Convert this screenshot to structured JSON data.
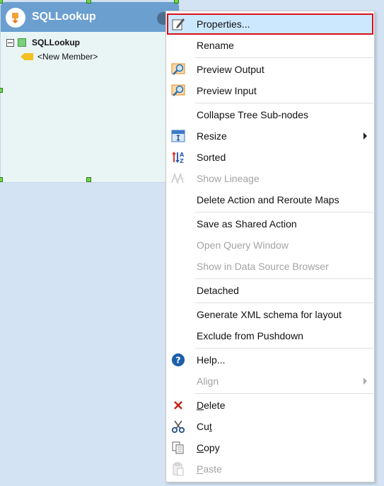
{
  "node": {
    "title": "SQLLookup",
    "tree_root": "SQLLookup",
    "tree_child": "<New Member>"
  },
  "menu": {
    "items": [
      {
        "label": "Properties...",
        "icon": "pencil-edit-icon",
        "enabled": true,
        "selected": true
      },
      {
        "label": "Rename",
        "icon": "",
        "enabled": true
      },
      {
        "label": "Preview Output",
        "icon": "magnifier-preview-icon",
        "enabled": true
      },
      {
        "label": "Preview Input",
        "icon": "magnifier-preview-icon",
        "enabled": true
      },
      {
        "label": "Collapse Tree Sub-nodes",
        "icon": "",
        "enabled": true
      },
      {
        "label": "Resize",
        "icon": "resize-icon",
        "enabled": true,
        "submenu": true
      },
      {
        "label": "Sorted",
        "icon": "sort-icon",
        "enabled": true
      },
      {
        "label": "Show Lineage",
        "icon": "lineage-icon",
        "enabled": false
      },
      {
        "label": "Delete Action and Reroute Maps",
        "icon": "",
        "enabled": true
      },
      {
        "label": "Save as Shared Action",
        "icon": "",
        "enabled": true
      },
      {
        "label": "Open Query Window",
        "icon": "",
        "enabled": false
      },
      {
        "label": "Show in Data Source Browser",
        "icon": "",
        "enabled": false
      },
      {
        "label": "Detached",
        "icon": "",
        "enabled": true
      },
      {
        "label": "Generate XML schema for layout",
        "icon": "",
        "enabled": true
      },
      {
        "label": "Exclude from Pushdown",
        "icon": "",
        "enabled": true
      },
      {
        "label": "Help...",
        "icon": "help-icon",
        "enabled": true
      },
      {
        "label": "Align",
        "icon": "",
        "enabled": false,
        "submenu": true
      },
      {
        "label": "Delete",
        "icon": "delete-x-icon",
        "enabled": true,
        "mnemonic": "D"
      },
      {
        "label": "Cut",
        "icon": "scissors-icon",
        "enabled": true,
        "mnemonic": "t"
      },
      {
        "label": "Copy",
        "icon": "copy-icon",
        "enabled": true,
        "mnemonic": "C"
      },
      {
        "label": "Paste",
        "icon": "paste-icon",
        "enabled": false,
        "mnemonic": "P"
      }
    ]
  },
  "colors": {
    "canvas": "#d3e3f4",
    "node_header": "#6a9fd0",
    "selection": "#cce8ff",
    "highlight_border": "#d6111a"
  }
}
